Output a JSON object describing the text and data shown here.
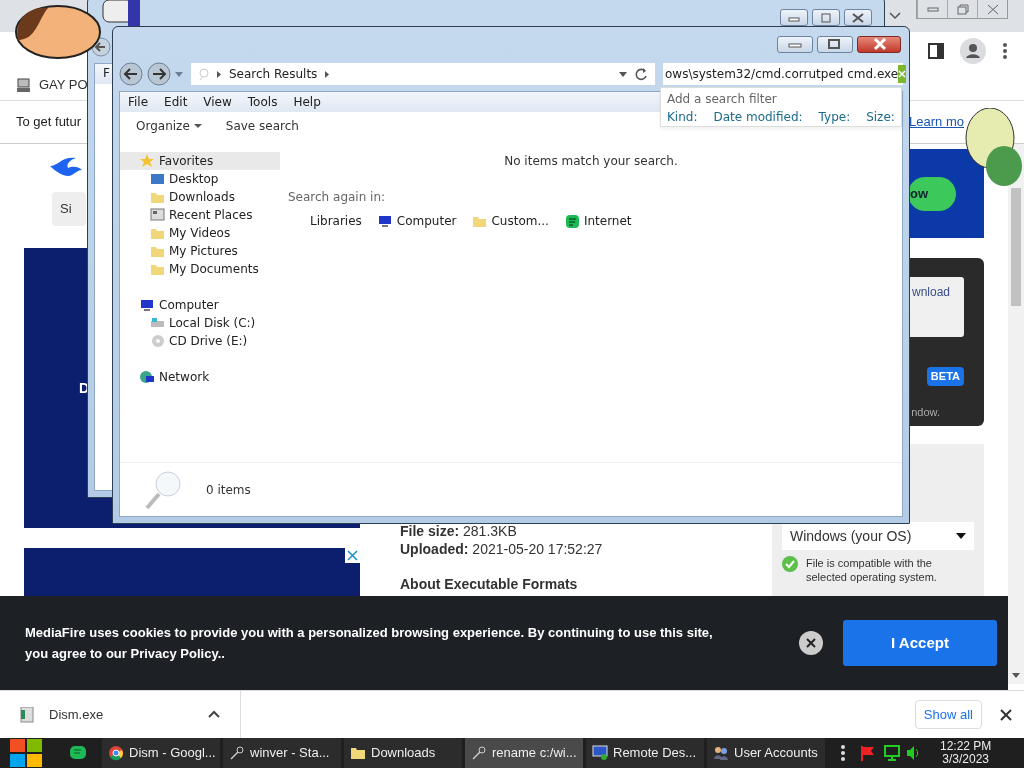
{
  "browser": {
    "bookmark": "GAY PO",
    "infobar": {
      "text": "To get futur",
      "link": "Learn mo"
    },
    "sign_button": "Si",
    "ad_text": "D",
    "details": [
      {
        "label": "File size:",
        "value": "281.3KB"
      },
      {
        "label": "Uploaded:",
        "value": "2021-05-20 17:52:27"
      }
    ],
    "about_heading": "About Executable Formats",
    "ad_button": "ow",
    "download_panel": {
      "link": "wnload",
      "badge": "BETA",
      "note": "ndow."
    },
    "os_select": "Windows (your OS)",
    "compat_note": "File is compatible with the selected operating system."
  },
  "back_window": {
    "menu_letter": "F"
  },
  "explorer": {
    "breadcrumb": "Search Results",
    "search_value": "ows\\system32/cmd.corrutped cmd.exe",
    "filter": {
      "title": "Add a search filter",
      "options": [
        "Kind:",
        "Date modified:",
        "Type:",
        "Size:"
      ]
    },
    "menu": [
      "File",
      "Edit",
      "View",
      "Tools",
      "Help"
    ],
    "toolbar": [
      {
        "label": "Organize",
        "kind": "dropdown"
      },
      {
        "label": "Save search",
        "kind": "plain"
      }
    ],
    "nav": [
      {
        "label": "Favorites",
        "kind": "star",
        "selected": true,
        "children": [
          {
            "label": "Desktop",
            "kind": "desktop",
            "selected": false
          },
          {
            "label": "Downloads",
            "kind": "folder",
            "selected": false
          },
          {
            "label": "Recent Places",
            "kind": "recent",
            "selected": false
          },
          {
            "label": "My Videos",
            "kind": "folder",
            "selected": false
          },
          {
            "label": "My Pictures",
            "kind": "folder",
            "selected": false
          },
          {
            "label": "My Documents",
            "kind": "folder",
            "selected": false
          }
        ]
      },
      {
        "label": "Computer",
        "kind": "computer",
        "selected": false,
        "children": [
          {
            "label": "Local Disk (C:)",
            "kind": "disk",
            "selected": false
          },
          {
            "label": "CD Drive (E:)",
            "kind": "cd",
            "selected": false
          }
        ]
      },
      {
        "label": "Network",
        "kind": "network",
        "selected": false
      }
    ],
    "empty_message": "No items match your search.",
    "search_again": "Search again in:",
    "locations": [
      {
        "label": "Libraries",
        "kind": "plain"
      },
      {
        "label": "Computer",
        "kind": "computer"
      },
      {
        "label": "Custom...",
        "kind": "folder"
      },
      {
        "label": "Internet",
        "kind": "internet"
      }
    ],
    "status": "0 items"
  },
  "cookie_bar": {
    "text": "MediaFire uses cookies to provide you with a personalized browsing experience. By continuing to use this site, you agree to our Privacy Policy..",
    "button": "I Accept"
  },
  "download_bar": {
    "file": "Dism.exe",
    "show_all": "Show all"
  },
  "taskbar": {
    "tasks": [
      {
        "label": "Dism - Googl...",
        "kind": "browser",
        "selected": false
      },
      {
        "label": "winver - Sta...",
        "kind": "search",
        "selected": false
      },
      {
        "label": "Downloads",
        "kind": "folder",
        "selected": false
      },
      {
        "label": "rename c:/wi...",
        "kind": "search",
        "selected": true
      },
      {
        "label": "Remote Des...",
        "kind": "remote",
        "selected": false
      },
      {
        "label": "User Accounts",
        "kind": "users",
        "selected": false
      }
    ],
    "time": "12:22 PM",
    "date": "3/3/2023"
  }
}
